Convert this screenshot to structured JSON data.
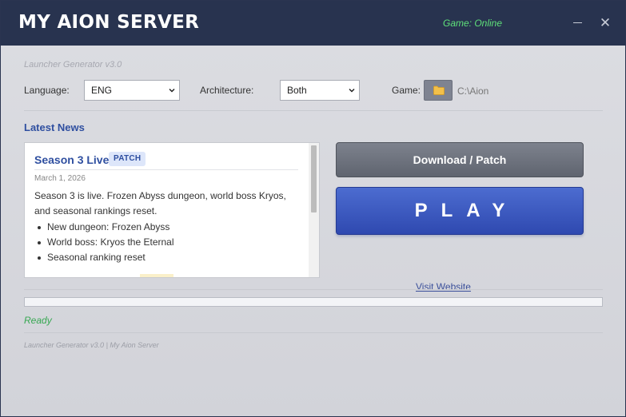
{
  "titlebar": {
    "app_title": "MY AION SERVER",
    "game_status": "Game: Online",
    "status_color": "#5fe07a",
    "minimize_icon": "minimize-icon",
    "close_label": "✕"
  },
  "subtitle": "Launcher Generator v3.0",
  "settings": {
    "language_label": "Language:",
    "language_value": "ENG",
    "architecture_label": "Architecture:",
    "architecture_value": "Both",
    "game_label": "Game:",
    "game_path": "C:\\Aion",
    "folder_icon": "folder-icon"
  },
  "news": {
    "heading": "Latest News",
    "item": {
      "title": "Season 3 Live!",
      "badge": "PATCH",
      "date": "March 1, 2026",
      "body": "Season 3 is live. Frozen Abyss dungeon, world boss Kryos, and seasonal rankings reset.",
      "bullets": [
        "New dungeon: Frozen Abyss",
        "World boss: Kryos the Eternal",
        "Seasonal ranking reset"
      ]
    }
  },
  "actions": {
    "download_label": "Download / Patch",
    "play_label": "PLAY",
    "visit_label": "Visit Website"
  },
  "progress": {
    "fraction": 0
  },
  "status": "Ready",
  "footer": "Launcher Generator v3.0 | My Aion Server",
  "colors": {
    "titlebar_bg": "#28334f",
    "accent_blue": "#2f4fa0",
    "play_blue": "#3a58c0",
    "ready_green": "#37a852"
  }
}
